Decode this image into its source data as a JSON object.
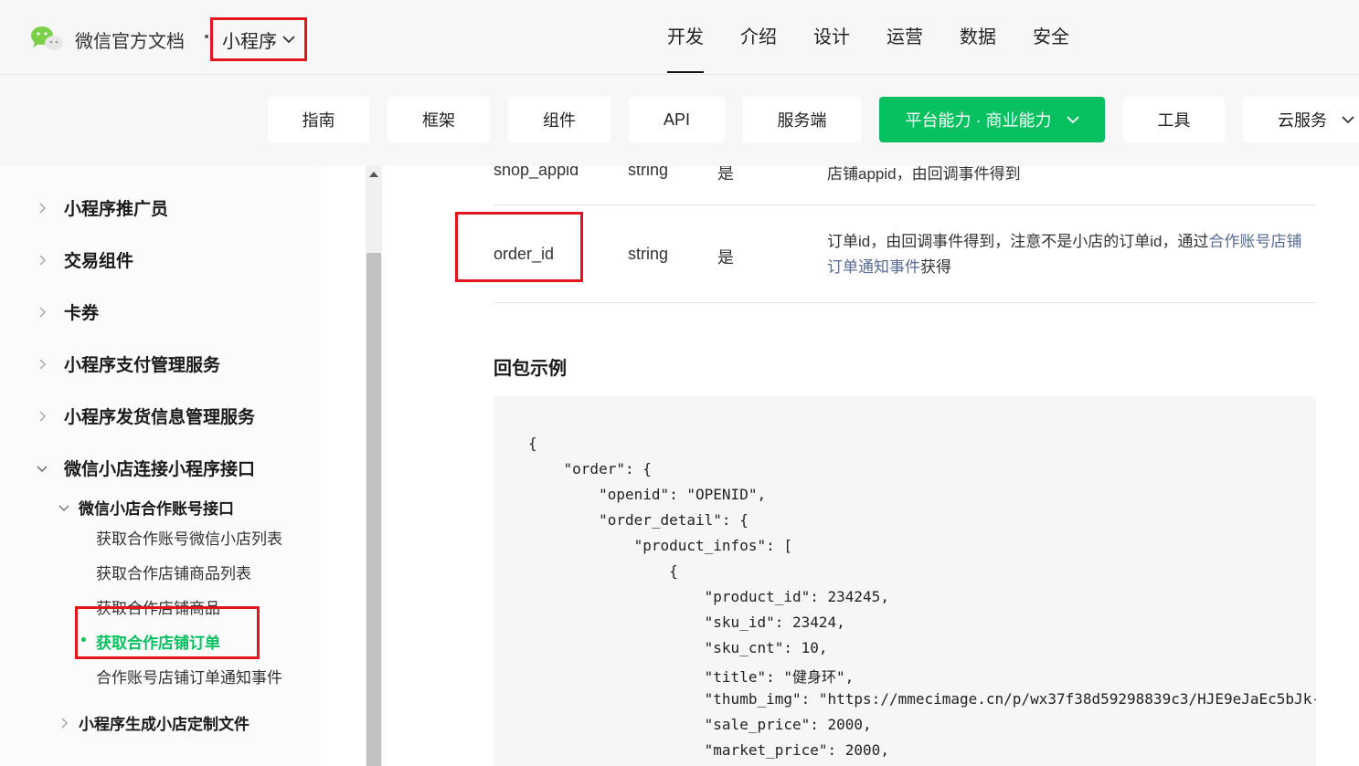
{
  "header": {
    "brand": "微信官方文档",
    "product_switch": "小程序",
    "nav": [
      "开发",
      "介绍",
      "设计",
      "运营",
      "数据",
      "安全"
    ],
    "active_nav": "开发"
  },
  "tabs": [
    "指南",
    "框架",
    "组件",
    "API",
    "服务端",
    "平台能力 · 商业能力",
    "工具",
    "云服务"
  ],
  "active_tab": "平台能力 · 商业能力",
  "sidebar": {
    "items": [
      "小程序推广员",
      "交易组件",
      "卡券",
      "小程序支付管理服务",
      "小程序发货信息管理服务",
      "微信小店连接小程序接口"
    ],
    "sub_group": "微信小店合作账号接口",
    "leaves": [
      "获取合作账号微信小店列表",
      "获取合作店铺商品列表",
      "获取合作店铺商品",
      "获取合作店铺订单",
      "合作账号店铺订单通知事件"
    ],
    "active_leaf": "获取合作店铺订单",
    "next_group": "小程序生成小店定制文件"
  },
  "params": {
    "row1": {
      "name": "shop_appid",
      "type": "string",
      "required": "是",
      "desc": "店铺appid，由回调事件得到"
    },
    "row2": {
      "name": "order_id",
      "type": "string",
      "required": "是",
      "desc_prefix": "订单id，由回调事件得到，注意不是小店的订单id，通过",
      "desc_link": "合作账号店铺订单通知事件",
      "desc_suffix": "获得"
    }
  },
  "section_title": "回包示例",
  "code_lines": [
    "{",
    "    \"order\": {",
    "        \"openid\": \"OPENID\",",
    "        \"order_detail\": {",
    "            \"product_infos\": [",
    "                {",
    "                    \"product_id\": 234245,",
    "                    \"sku_id\": 23424,",
    "                    \"sku_cnt\": 10,",
    "                    \"title\": \"健身环\",",
    "                    \"thumb_img\": \"https://mmecimage.cn/p/wx37f38d59298839c3/HJE9eJaEc5bJk-",
    "                    \"sale_price\": 2000,",
    "                    \"market_price\": 2000,"
  ],
  "colors": {
    "accent": "#07c160",
    "highlight": "#e3141c",
    "link": "#576b95"
  }
}
